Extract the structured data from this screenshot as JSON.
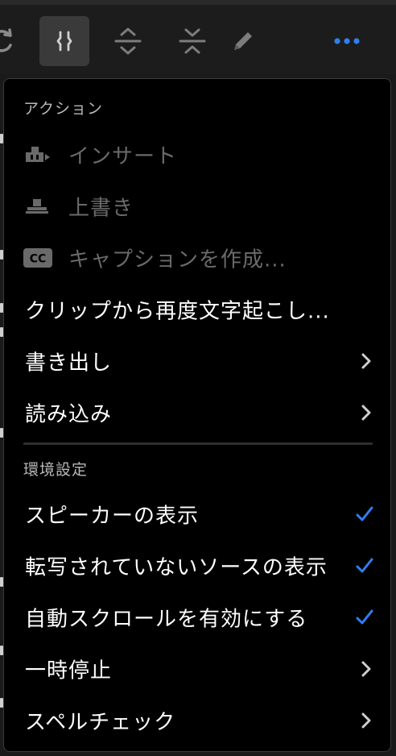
{
  "toolbar": {
    "icons": [
      "refresh-icon",
      "merge-icon",
      "expand-icon",
      "collapse-icon",
      "pencil-icon",
      "more-icon"
    ],
    "accent": "#2f7ff0"
  },
  "menu": {
    "sections": {
      "actions_header": "アクション",
      "prefs_header": "環境設定"
    },
    "items": {
      "insert": "インサート",
      "overwrite": "上書き",
      "caption": "キャプションを作成...",
      "caption_badge": "CC",
      "retranscribe": "クリップから再度文字起こし...",
      "export": "書き出し",
      "import": "読み込み",
      "show_speakers": "スピーカーの表示",
      "show_untranscribed": "転写されていないソースの表示",
      "autoscroll": "自動スクロールを有効にする",
      "pause": "一時停止",
      "spellcheck": "スペルチェック"
    },
    "checked_color": "#2f7ff0"
  }
}
